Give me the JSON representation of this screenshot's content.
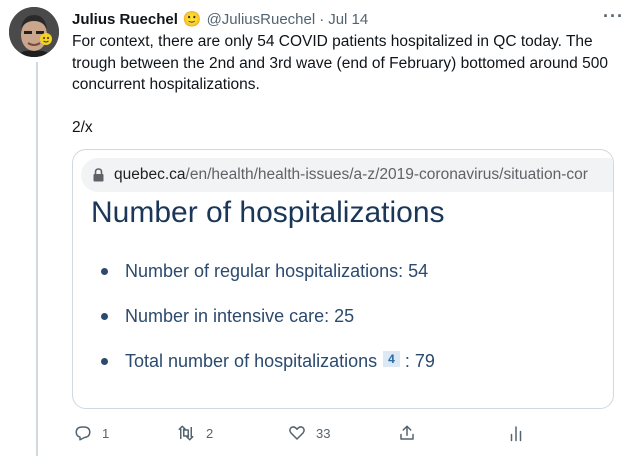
{
  "author": {
    "name": "Julius Ruechel",
    "emoji": "🙂",
    "handle": "@JuliusRuechel",
    "separator": "·",
    "date": "Jul 14"
  },
  "tweet": {
    "text": "For context, there are only 54 COVID patients hospitalized in QC today. The trough between the 2nd and 3rd wave (end of February) bottomed around 500 concurrent hospitalizations.",
    "thread_marker": "2/x"
  },
  "card": {
    "url_domain": "quebec.ca",
    "url_path": "/en/health/health-issues/a-z/2019-coronavirus/situation-cor",
    "heading": "Number of hospitalizations",
    "items": [
      {
        "label": "Number of regular hospitalizations: 54"
      },
      {
        "label": "Number in intensive care: 25"
      },
      {
        "label": "Total number of hospitalizations",
        "footnote": "4",
        "suffix": ": 79"
      }
    ]
  },
  "actions": {
    "replies": "1",
    "retweets": "2",
    "likes": "33"
  },
  "colors": {
    "heading": "#1a3658",
    "list_text": "#2b4a6e",
    "muted": "#536471",
    "border": "#cfd9de"
  }
}
